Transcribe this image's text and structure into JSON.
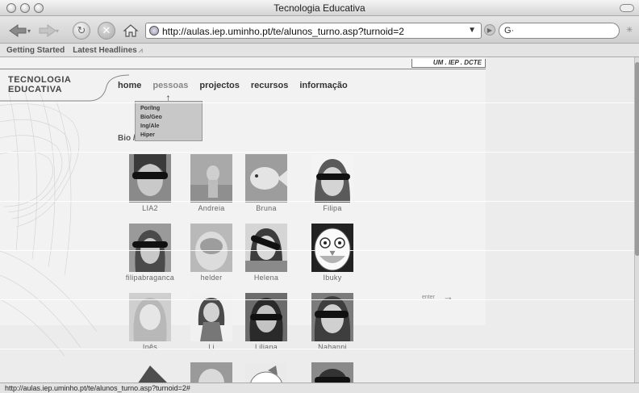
{
  "window": {
    "title": "Tecnologia Educativa"
  },
  "toolbar": {
    "url": "http://aulas.iep.uminho.pt/te/alunos_turno.asp?turnoid=2",
    "search_engine": "G·"
  },
  "bookmarks": [
    "Getting Started",
    "Latest Headlines"
  ],
  "site": {
    "breadcrumb": "UM . IEP . DCTE",
    "logo_line1": "TECNOLOGIA",
    "logo_line2": "EDUCATIVA",
    "nav": [
      "home",
      "pessoas",
      "projectos",
      "recursos",
      "informação"
    ],
    "dropdown": [
      "Por/Ing",
      "Bio/Geo",
      "Ing/Ale",
      "Hiper"
    ],
    "section_title": "Bio /",
    "students": [
      [
        "LIA2",
        "Andreia",
        "Bruna",
        "Filipa"
      ],
      [
        "filipabraganca",
        "helder",
        "Helena",
        "Ibuky"
      ],
      [
        "Inês",
        "Li",
        "Liliana",
        "Nahanni"
      ]
    ],
    "enter_label": "enter"
  },
  "status": {
    "text": "http://aulas.iep.uminho.pt/te/alunos_turno.asp?turnoid=2#"
  },
  "icons": {
    "back": "back-arrow-icon",
    "forward": "forward-arrow-icon",
    "reload": "reload-icon",
    "stop": "stop-icon",
    "home": "home-icon"
  }
}
